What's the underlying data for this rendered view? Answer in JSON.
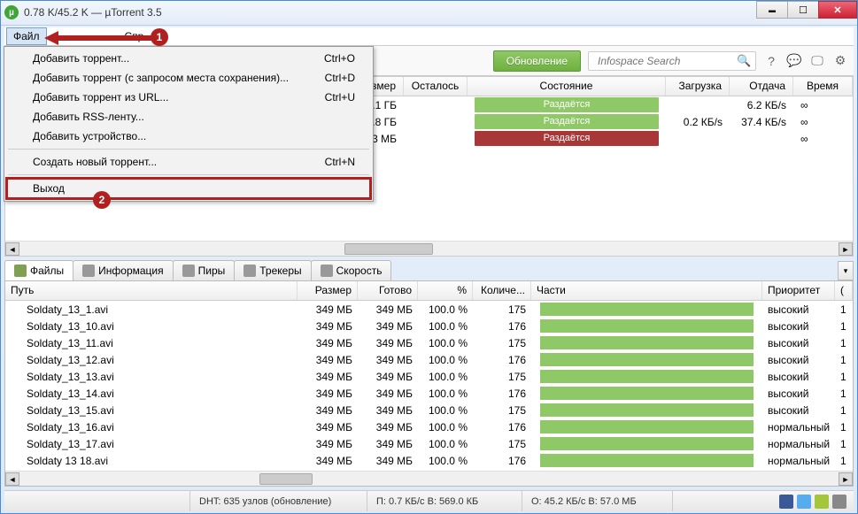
{
  "window": {
    "title": "0.78 K/45.2 K — µTorrent 3.5"
  },
  "menubar": {
    "file": "Файл",
    "other": "Спр"
  },
  "annotations": {
    "badge1": "1",
    "badge2": "2"
  },
  "file_menu": {
    "items": [
      {
        "label": "Добавить торрент...",
        "shortcut": "Ctrl+O"
      },
      {
        "label": "Добавить торрент (с запросом места сохранения)...",
        "shortcut": "Ctrl+D"
      },
      {
        "label": "Добавить торрент из URL...",
        "shortcut": "Ctrl+U"
      },
      {
        "label": "Добавить RSS-ленту...",
        "shortcut": ""
      },
      {
        "label": "Добавить устройство...",
        "shortcut": ""
      }
    ],
    "create": {
      "label": "Создать новый торрент...",
      "shortcut": "Ctrl+N"
    },
    "exit": {
      "label": "Выход",
      "shortcut": ""
    }
  },
  "toolbar": {
    "update": "Обновление",
    "search_placeholder": "Infospace Search"
  },
  "torrents": {
    "headers": {
      "size": "змер",
      "remaining": "Осталось",
      "status": "Состояние",
      "download": "Загрузка",
      "upload": "Отдача",
      "time": "Время"
    },
    "rows": [
      {
        "size": ".1 ГБ",
        "status": "Раздаётся",
        "status_color": "green",
        "download": "",
        "upload": "6.2 КБ/s",
        "time": "∞"
      },
      {
        "size": ".8 ГБ",
        "status": "Раздаётся",
        "status_color": "green",
        "download": "0.2 КБ/s",
        "upload": "37.4 КБ/s",
        "time": "∞"
      },
      {
        "size": "3 МБ",
        "status": "Раздаётся",
        "status_color": "red",
        "download": "",
        "upload": "",
        "time": "∞"
      }
    ]
  },
  "tabs": {
    "files": "Файлы",
    "info": "Информация",
    "peers": "Пиры",
    "trackers": "Трекеры",
    "speed": "Скорость"
  },
  "files": {
    "headers": {
      "path": "Путь",
      "size": "Размер",
      "done": "Готово",
      "pct": "%",
      "pieces": "Количе...",
      "parts": "Части",
      "priority": "Приоритет",
      "last": "("
    },
    "rows": [
      {
        "path": "Soldaty_13_1.avi",
        "size": "349 МБ",
        "done": "349 МБ",
        "pct": "100.0 %",
        "pieces": "175",
        "priority": "высокий",
        "last": "1"
      },
      {
        "path": "Soldaty_13_10.avi",
        "size": "349 МБ",
        "done": "349 МБ",
        "pct": "100.0 %",
        "pieces": "176",
        "priority": "высокий",
        "last": "1"
      },
      {
        "path": "Soldaty_13_11.avi",
        "size": "349 МБ",
        "done": "349 МБ",
        "pct": "100.0 %",
        "pieces": "175",
        "priority": "высокий",
        "last": "1"
      },
      {
        "path": "Soldaty_13_12.avi",
        "size": "349 МБ",
        "done": "349 МБ",
        "pct": "100.0 %",
        "pieces": "176",
        "priority": "высокий",
        "last": "1"
      },
      {
        "path": "Soldaty_13_13.avi",
        "size": "349 МБ",
        "done": "349 МБ",
        "pct": "100.0 %",
        "pieces": "175",
        "priority": "высокий",
        "last": "1"
      },
      {
        "path": "Soldaty_13_14.avi",
        "size": "349 МБ",
        "done": "349 МБ",
        "pct": "100.0 %",
        "pieces": "176",
        "priority": "высокий",
        "last": "1"
      },
      {
        "path": "Soldaty_13_15.avi",
        "size": "349 МБ",
        "done": "349 МБ",
        "pct": "100.0 %",
        "pieces": "175",
        "priority": "высокий",
        "last": "1"
      },
      {
        "path": "Soldaty_13_16.avi",
        "size": "349 МБ",
        "done": "349 МБ",
        "pct": "100.0 %",
        "pieces": "176",
        "priority": "нормальный",
        "last": "1"
      },
      {
        "path": "Soldaty_13_17.avi",
        "size": "349 МБ",
        "done": "349 МБ",
        "pct": "100.0 %",
        "pieces": "175",
        "priority": "нормальный",
        "last": "1"
      },
      {
        "path": "Soldaty 13 18.avi",
        "size": "349 МБ",
        "done": "349 МБ",
        "pct": "100.0 %",
        "pieces": "176",
        "priority": "нормальный",
        "last": "1"
      }
    ]
  },
  "statusbar": {
    "dht": "DHT: 635 узлов (обновление)",
    "down": "П: 0.7 КБ/с В: 569.0 КБ",
    "up": "О: 45.2 КБ/с В: 57.0 МБ"
  }
}
